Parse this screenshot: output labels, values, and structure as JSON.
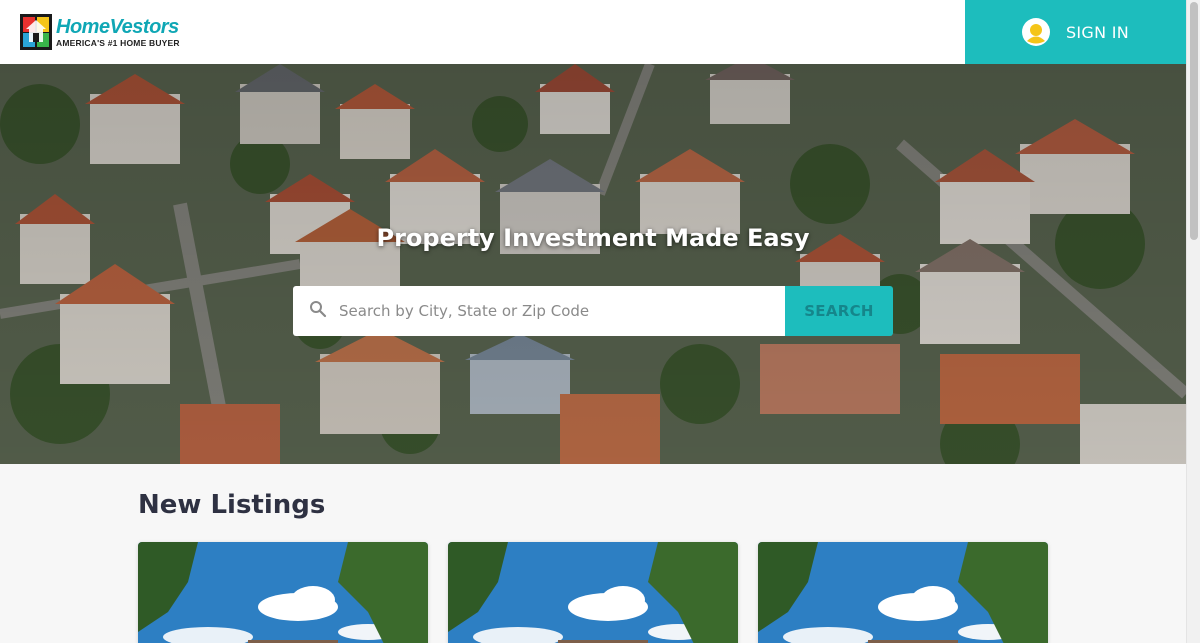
{
  "header": {
    "logo_name": "HomeVestors",
    "logo_tagline": "AMERICA'S #1 HOME BUYER",
    "signin_label": "SIGN IN",
    "signin_icon": "user-avatar-icon"
  },
  "hero": {
    "title": "Property Investment Made Easy",
    "search": {
      "placeholder": "Search by City, State or Zip Code",
      "value": "",
      "icon": "search-icon",
      "button_label": "SEARCH"
    }
  },
  "listings": {
    "heading": "New Listings",
    "cards": [
      {
        "image": "house-photo"
      },
      {
        "image": "house-photo"
      },
      {
        "image": "house-photo"
      }
    ]
  },
  "colors": {
    "accent": "#1dbdbd",
    "heading": "#2e3142",
    "logo_teal": "#0fa7b5"
  }
}
